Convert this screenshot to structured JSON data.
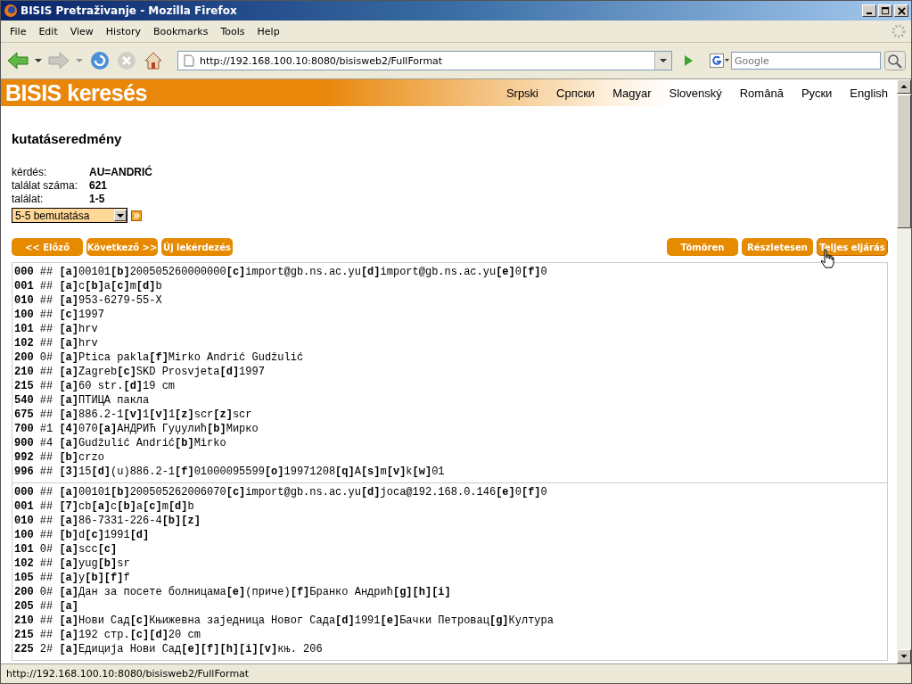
{
  "window": {
    "title": "BISIS Pretraživanje - Mozilla Firefox"
  },
  "menu": [
    "File",
    "Edit",
    "View",
    "History",
    "Bookmarks",
    "Tools",
    "Help"
  ],
  "address": {
    "value": "http://192.168.100.10:8080/bisisweb2/FullFormat"
  },
  "search": {
    "placeholder": "Google"
  },
  "page": {
    "logo": "BISIS keresés",
    "languages": [
      "Srpski",
      "Српски",
      "Magyar",
      "Slovenský",
      "Română",
      "Руски",
      "English"
    ],
    "heading": "kutatáseredmény",
    "info": [
      {
        "label": "kérdés:",
        "value": "AU=ANDRIĆ"
      },
      {
        "label": "találat száma:",
        "value": "621"
      },
      {
        "label": "találat:",
        "value": "1-5"
      }
    ],
    "select": {
      "value": "5-5 bemutatása"
    },
    "left_buttons": [
      "<< Előző",
      "Következő >>",
      "Új lekérdezés"
    ],
    "right_buttons": [
      {
        "label": "Tömören",
        "selected": false
      },
      {
        "label": "Részletesen",
        "selected": false
      },
      {
        "label": "Teljes eljárás",
        "selected": true
      }
    ],
    "records": [
      [
        {
          "tag": "000",
          "ind": "##",
          "content": "**[a]**00101**[b]**200505260000000**[c]**import@gb.ns.ac.yu**[d]**import@gb.ns.ac.yu**[e]**0**[f]**0"
        },
        {
          "tag": "001",
          "ind": "##",
          "content": "**[a]**c**[b]**a**[c]**m**[d]**b"
        },
        {
          "tag": "010",
          "ind": "##",
          "content": "**[a]**953-6279-55-X"
        },
        {
          "tag": "100",
          "ind": "##",
          "content": "**[c]**1997"
        },
        {
          "tag": "101",
          "ind": "##",
          "content": "**[a]**hrv"
        },
        {
          "tag": "102",
          "ind": "##",
          "content": "**[a]**hrv"
        },
        {
          "tag": "200",
          "ind": "0#",
          "content": "**[a]**Ptica pakla**[f]**Mirko Andrić Gudžulić"
        },
        {
          "tag": "210",
          "ind": "##",
          "content": "**[a]**Zagreb**[c]**SKD Prosvjeta**[d]**1997"
        },
        {
          "tag": "215",
          "ind": "##",
          "content": "**[a]**60 str.**[d]**19 cm"
        },
        {
          "tag": "540",
          "ind": "##",
          "content": "**[a]**ПТИЦА пакла"
        },
        {
          "tag": "675",
          "ind": "##",
          "content": "**[a]**886.2-1**[v]**1**[v]**1**[z]**scr**[z]**scr"
        },
        {
          "tag": "700",
          "ind": "#1",
          "content": "**[4]**070**[a]**АНДРИЋ Гуџулић**[b]**Мирко"
        },
        {
          "tag": "900",
          "ind": "#4",
          "content": "**[a]**Gudžulić Andrić**[b]**Mirko"
        },
        {
          "tag": "992",
          "ind": "##",
          "content": "**[b]**crzo"
        },
        {
          "tag": "996",
          "ind": "##",
          "content": "**[3]**15**[d]**(u)886.2-1**[f]**01000095599**[o]**19971208**[q]**A**[s]**m**[v]**k**[w]**01"
        }
      ],
      [
        {
          "tag": "000",
          "ind": "##",
          "content": "**[a]**00101**[b]**200505262006070**[c]**import@gb.ns.ac.yu**[d]**joca@192.168.0.146**[e]**0**[f]**0"
        },
        {
          "tag": "001",
          "ind": "##",
          "content": "**[7]**cb**[a]**c**[b]**a**[c]**m**[d]**b"
        },
        {
          "tag": "010",
          "ind": "##",
          "content": "**[a]**86-7331-226-4**[b][z]**"
        },
        {
          "tag": "100",
          "ind": "##",
          "content": "**[b]**d**[c]**1991**[d]**"
        },
        {
          "tag": "101",
          "ind": "0#",
          "content": "**[a]**scc**[c]**"
        },
        {
          "tag": "102",
          "ind": "##",
          "content": "**[a]**yug**[b]**sr"
        },
        {
          "tag": "105",
          "ind": "##",
          "content": "**[a]**y**[b][f]**f"
        },
        {
          "tag": "200",
          "ind": "0#",
          "content": "**[a]**Дан за посете болницама**[e]**(приче)**[f]**Бранко Андрић**[g][h][i]**"
        },
        {
          "tag": "205",
          "ind": "##",
          "content": "**[a]**"
        },
        {
          "tag": "210",
          "ind": "##",
          "content": "**[a]**Нови Сад**[c]**Књижевна заједница Новог Сада**[d]**1991**[e]**Бачки Петровац**[g]**Култура"
        },
        {
          "tag": "215",
          "ind": "##",
          "content": "**[a]**192 стр.**[c][d]**20 cm"
        },
        {
          "tag": "225",
          "ind": "2#",
          "content": "**[a]**Едиција Нови Сад**[e][f][h][i][v]**књ. 206"
        }
      ]
    ]
  },
  "status_bar": "http://192.168.100.10:8080/bisisweb2/FullFormat"
}
